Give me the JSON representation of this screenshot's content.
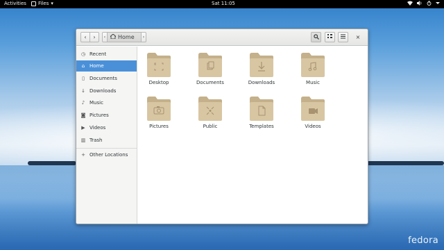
{
  "topbar": {
    "activities": "Activities",
    "app_name": "Files",
    "app_menu_arrow": "▾",
    "clock": "Sat 11:05",
    "status_icons": [
      "network-icon",
      "volume-icon",
      "power-icon",
      "menu-arrow-icon"
    ]
  },
  "window": {
    "nav": {
      "back": "‹",
      "forward": "›",
      "path_left": "‹",
      "path_right": "›"
    },
    "path_home_label": "Home",
    "close": "×"
  },
  "sidebar": {
    "items": [
      {
        "label": "Recent",
        "icon": "clock-icon",
        "glyph": "◷"
      },
      {
        "label": "Home",
        "icon": "home-icon",
        "glyph": "⌂",
        "active": true
      },
      {
        "label": "Documents",
        "icon": "document-icon",
        "glyph": "▯"
      },
      {
        "label": "Downloads",
        "icon": "download-icon",
        "glyph": "↓"
      },
      {
        "label": "Music",
        "icon": "music-icon",
        "glyph": "♪"
      },
      {
        "label": "Pictures",
        "icon": "camera-icon",
        "glyph": "◙"
      },
      {
        "label": "Videos",
        "icon": "video-icon",
        "glyph": "▶"
      },
      {
        "label": "Trash",
        "icon": "trash-icon",
        "glyph": "▥"
      },
      {
        "label": "Other Locations",
        "icon": "plus-icon",
        "glyph": "+"
      }
    ]
  },
  "folders": [
    {
      "label": "Desktop",
      "icon": "desktop-folder-icon"
    },
    {
      "label": "Documents",
      "icon": "documents-folder-icon"
    },
    {
      "label": "Downloads",
      "icon": "downloads-folder-icon"
    },
    {
      "label": "Music",
      "icon": "music-folder-icon"
    },
    {
      "label": "Pictures",
      "icon": "pictures-folder-icon"
    },
    {
      "label": "Public",
      "icon": "public-folder-icon"
    },
    {
      "label": "Templates",
      "icon": "templates-folder-icon"
    },
    {
      "label": "Videos",
      "icon": "videos-folder-icon"
    }
  ],
  "desktop": {
    "brand": "fedora"
  },
  "colors": {
    "accent": "#4a90d9",
    "folder": "#d8c6a3",
    "folder_dark": "#c4b08a",
    "topbar": "#000000"
  }
}
